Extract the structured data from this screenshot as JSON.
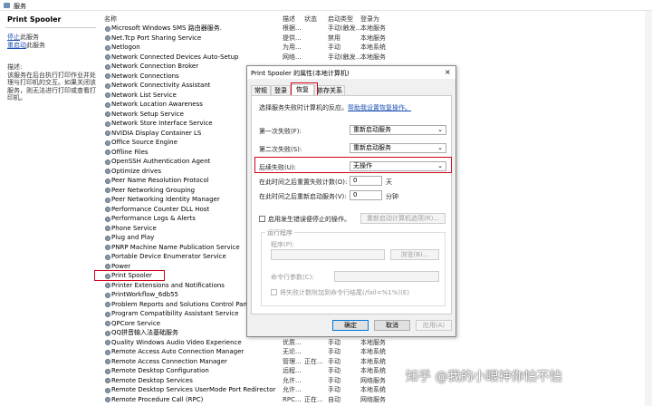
{
  "window": {
    "title": "服务"
  },
  "left_panel": {
    "service_title": "Print Spooler",
    "stop_link": "停止",
    "stop_suffix": "此服务",
    "restart_link": "重启动",
    "restart_suffix": "此服务",
    "desc_label": "描述:",
    "description": "该服务在后台执行打印作业并处理与打印机的交互。如果关闭该服务，则无法进行打印或查看打印机。"
  },
  "columns": {
    "name": "名称",
    "desc": "描述",
    "status": "状态",
    "startup": "启动类型",
    "logon": "登录为"
  },
  "services": [
    {
      "name": "Microsoft Windows SMS 路由器服务.",
      "desc": "根据...",
      "status": "",
      "startup": "手动(触发...",
      "logon": "本地服务"
    },
    {
      "name": "Net.Tcp Port Sharing Service",
      "desc": "提供...",
      "status": "",
      "startup": "禁用",
      "logon": "本地服务"
    },
    {
      "name": "Netlogon",
      "desc": "为用...",
      "status": "",
      "startup": "手动",
      "logon": "本地系统"
    },
    {
      "name": "Network Connected Devices Auto-Setup",
      "desc": "网络...",
      "status": "",
      "startup": "手动(触发...",
      "logon": "本地服务"
    },
    {
      "name": "Network Connection Broker",
      "desc": "",
      "status": "",
      "startup": "",
      "logon": ""
    },
    {
      "name": "Network Connections",
      "desc": "",
      "status": "",
      "startup": "",
      "logon": ""
    },
    {
      "name": "Network Connectivity Assistant",
      "desc": "",
      "status": "",
      "startup": "",
      "logon": ""
    },
    {
      "name": "Network List Service",
      "desc": "",
      "status": "",
      "startup": "",
      "logon": ""
    },
    {
      "name": "Network Location Awareness",
      "desc": "",
      "status": "",
      "startup": "",
      "logon": ""
    },
    {
      "name": "Network Setup Service",
      "desc": "",
      "status": "",
      "startup": "",
      "logon": ""
    },
    {
      "name": "Network Store Interface Service",
      "desc": "",
      "status": "",
      "startup": "",
      "logon": ""
    },
    {
      "name": "NVIDIA Display Container LS",
      "desc": "",
      "status": "",
      "startup": "",
      "logon": ""
    },
    {
      "name": "Office Source Engine",
      "desc": "",
      "status": "",
      "startup": "",
      "logon": ""
    },
    {
      "name": "Offline Files",
      "desc": "",
      "status": "",
      "startup": "",
      "logon": ""
    },
    {
      "name": "OpenSSH Authentication Agent",
      "desc": "",
      "status": "",
      "startup": "",
      "logon": ""
    },
    {
      "name": "Optimize drives",
      "desc": "",
      "status": "",
      "startup": "",
      "logon": ""
    },
    {
      "name": "Peer Name Resolution Protocol",
      "desc": "",
      "status": "",
      "startup": "",
      "logon": ""
    },
    {
      "name": "Peer Networking Grouping",
      "desc": "",
      "status": "",
      "startup": "",
      "logon": ""
    },
    {
      "name": "Peer Networking Identity Manager",
      "desc": "",
      "status": "",
      "startup": "",
      "logon": ""
    },
    {
      "name": "Performance Counter DLL Host",
      "desc": "",
      "status": "",
      "startup": "",
      "logon": ""
    },
    {
      "name": "Performance Logs & Alerts",
      "desc": "",
      "status": "",
      "startup": "",
      "logon": ""
    },
    {
      "name": "Phone Service",
      "desc": "",
      "status": "",
      "startup": "",
      "logon": ""
    },
    {
      "name": "Plug and Play",
      "desc": "",
      "status": "",
      "startup": "",
      "logon": ""
    },
    {
      "name": "PNRP Machine Name Publication Service",
      "desc": "",
      "status": "",
      "startup": "",
      "logon": ""
    },
    {
      "name": "Portable Device Enumerator Service",
      "desc": "",
      "status": "",
      "startup": "",
      "logon": ""
    },
    {
      "name": "Power",
      "desc": "",
      "status": "",
      "startup": "",
      "logon": ""
    },
    {
      "name": "Print Spooler",
      "desc": "",
      "status": "",
      "startup": "",
      "logon": ""
    },
    {
      "name": "Printer Extensions and Notifications",
      "desc": "",
      "status": "",
      "startup": "",
      "logon": ""
    },
    {
      "name": "PrintWorkflow_6db55",
      "desc": "",
      "status": "",
      "startup": "",
      "logon": ""
    },
    {
      "name": "Problem Reports and Solutions Control Panel Supp",
      "desc": "",
      "status": "",
      "startup": "",
      "logon": ""
    },
    {
      "name": "Program Compatibility Assistant Service",
      "desc": "",
      "status": "",
      "startup": "",
      "logon": ""
    },
    {
      "name": "QPCore Service",
      "desc": "",
      "status": "",
      "startup": "",
      "logon": ""
    },
    {
      "name": "QQ拼音输入法基础服务",
      "desc": "",
      "status": "",
      "startup": "",
      "logon": ""
    },
    {
      "name": "Quality Windows Audio Video Experience",
      "desc": "优质...",
      "status": "",
      "startup": "手动",
      "logon": "本地服务"
    },
    {
      "name": "Remote Access Auto Connection Manager",
      "desc": "无论...",
      "status": "",
      "startup": "手动",
      "logon": "本地系统"
    },
    {
      "name": "Remote Access Connection Manager",
      "desc": "管理...",
      "status": "正在...",
      "startup": "手动",
      "logon": "本地系统"
    },
    {
      "name": "Remote Desktop Configuration",
      "desc": "远程...",
      "status": "",
      "startup": "手动",
      "logon": "本地系统"
    },
    {
      "name": "Remote Desktop Services",
      "desc": "允许...",
      "status": "",
      "startup": "手动",
      "logon": "网络服务"
    },
    {
      "name": "Remote Desktop Services UserMode Port Redirector",
      "desc": "允许...",
      "status": "",
      "startup": "手动",
      "logon": "本地系统"
    },
    {
      "name": "Remote Procedure Call (RPC)",
      "desc": "RPC...",
      "status": "正在...",
      "startup": "自动",
      "logon": "网络服务"
    }
  ],
  "dialog": {
    "title": "Print Spooler 的属性(本地计算机)",
    "close": "×",
    "tabs": [
      "常规",
      "登录",
      "恢复",
      "依存关系"
    ],
    "active_tab": "恢复",
    "intro": "选择服务失败时计算机的反应。",
    "help_link": "帮助我设置恢复操作。",
    "first_failure_label": "第一次失败(F):",
    "first_failure_value": "重新启动服务",
    "second_failure_label": "第二次失败(S):",
    "second_failure_value": "重新启动服务",
    "subsequent_label": "后续失败(U):",
    "subsequent_value": "无操作",
    "reset_label": "在此时间之后重置失败计数(O):",
    "reset_value": "0",
    "reset_unit": "天",
    "restart_after_label": "在此时间之后重新启动服务(V):",
    "restart_after_value": "0",
    "restart_after_unit": "分钟",
    "enable_actions_label": "启用发生错误便停止的操作。",
    "restart_options_button": "重新启动计算机选项(R)...",
    "run_program_group": "运行程序",
    "program_label": "程序(P):",
    "browse_button": "浏览(B)...",
    "cmd_params_label": "命令行参数(C):",
    "append_fail_count_label": "将失败计数附加到命令行结尾(/fail=%1%)(E)",
    "ok_button": "确定",
    "cancel_button": "取消",
    "apply_button": "应用(A)"
  },
  "watermark": "知乎 @我的小眼神你怕不怕"
}
